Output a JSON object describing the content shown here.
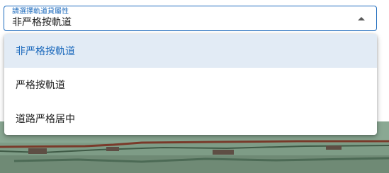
{
  "select": {
    "label": "請選擇軌道貸屬性",
    "value": "非严格按軌道",
    "arrow_icon": "menu-up-icon"
  },
  "menu": {
    "items": [
      {
        "label": "非严格按軌道",
        "selected": true
      },
      {
        "label": "严格按軌道",
        "selected": false
      },
      {
        "label": "道路严格居中",
        "selected": false
      }
    ]
  },
  "colors": {
    "accent": "#1e6bbd",
    "selected_bg": "#e2ebf5",
    "map_bg": "#8aa893",
    "map_line": "#7a3a2a"
  }
}
